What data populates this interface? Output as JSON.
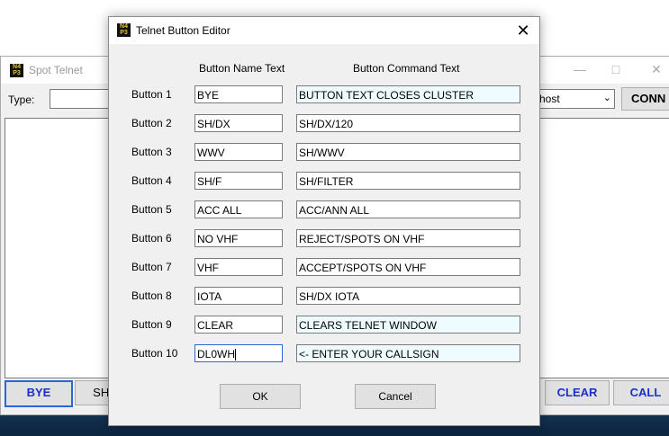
{
  "background_window": {
    "title": "Spot Telnet",
    "type_label": "Type:",
    "host_value": "host",
    "connect_label": "CONN",
    "bottom_buttons": [
      "BYE",
      "SH/",
      "CLEAR",
      "CALL"
    ]
  },
  "dialog": {
    "title": "Telnet Button Editor",
    "close_glyph": "✕",
    "headers": {
      "name": "Button Name Text",
      "command": "Button Command Text"
    },
    "rows": [
      {
        "label": "Button 1",
        "name": "BYE",
        "command": "BUTTON TEXT CLOSES CLUSTER"
      },
      {
        "label": "Button 2",
        "name": "SH/DX",
        "command": "SH/DX/120"
      },
      {
        "label": "Button 3",
        "name": "WWV",
        "command": "SH/WWV"
      },
      {
        "label": "Button 4",
        "name": "SH/F",
        "command": "SH/FILTER"
      },
      {
        "label": "Button 5",
        "name": "ACC ALL",
        "command": "ACC/ANN ALL"
      },
      {
        "label": "Button 6",
        "name": "NO VHF",
        "command": "REJECT/SPOTS ON VHF"
      },
      {
        "label": "Button 7",
        "name": "VHF",
        "command": "ACCEPT/SPOTS ON VHF"
      },
      {
        "label": "Button 8",
        "name": "IOTA",
        "command": "SH/DX IOTA"
      },
      {
        "label": "Button 9",
        "name": "CLEAR",
        "command": "CLEARS TELNET WINDOW"
      },
      {
        "label": "Button 10",
        "name": "DL0WH",
        "command": "<- ENTER YOUR CALLSIGN"
      }
    ],
    "ok_label": "OK",
    "cancel_label": "Cancel"
  },
  "colors": {
    "accent": "#2a66d8",
    "tinted_field": "#eefcff",
    "button_text_blue": "#1a2fc9"
  },
  "icons": {
    "app_logo": "app-logo-icon",
    "close": "close-icon",
    "dropdown": "chevron-down-icon"
  }
}
